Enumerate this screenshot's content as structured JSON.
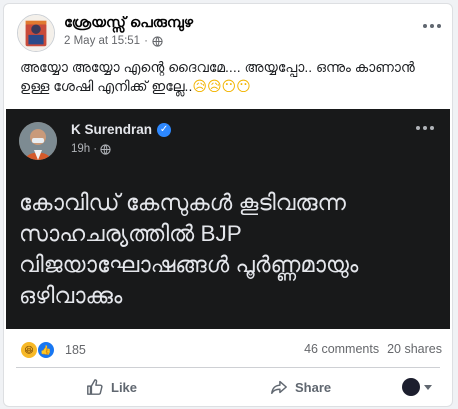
{
  "post": {
    "author": "ശ്രേയസ്സ് പെരുമ്പുഴ",
    "date": "2 May at 15:51",
    "separator": "·",
    "text": "അയ്യോ അയ്യോ എന്റെ ദൈവമേ.... അയ്യപ്പോ.. ഒന്നും കാണാൻ ഉള്ള ശേഷി എനിക്ക് ഇല്ലേ..",
    "emojis": "😥😥😶😶"
  },
  "embedded": {
    "name": "K Surendran",
    "verified_mark": "✓",
    "time": "19h",
    "separator": "·",
    "text": "കോവിഡ് കേസുകൾ കൂടിവരുന്ന സാഹചര്യത്തിൽ BJP വിജയാഘോഷങ്ങൾ പൂർണ്ണമായും ഒഴിവാക്കും"
  },
  "stats": {
    "reactions_count": "185",
    "comments": "46 comments",
    "shares": "20 shares",
    "haha_glyph": "😆",
    "like_glyph": "👍"
  },
  "actions": {
    "like_label": "Like",
    "share_label": "Share"
  },
  "colors": {
    "accent": "#1877f2",
    "dark_bg": "#18191a",
    "muted": "#65676b"
  }
}
